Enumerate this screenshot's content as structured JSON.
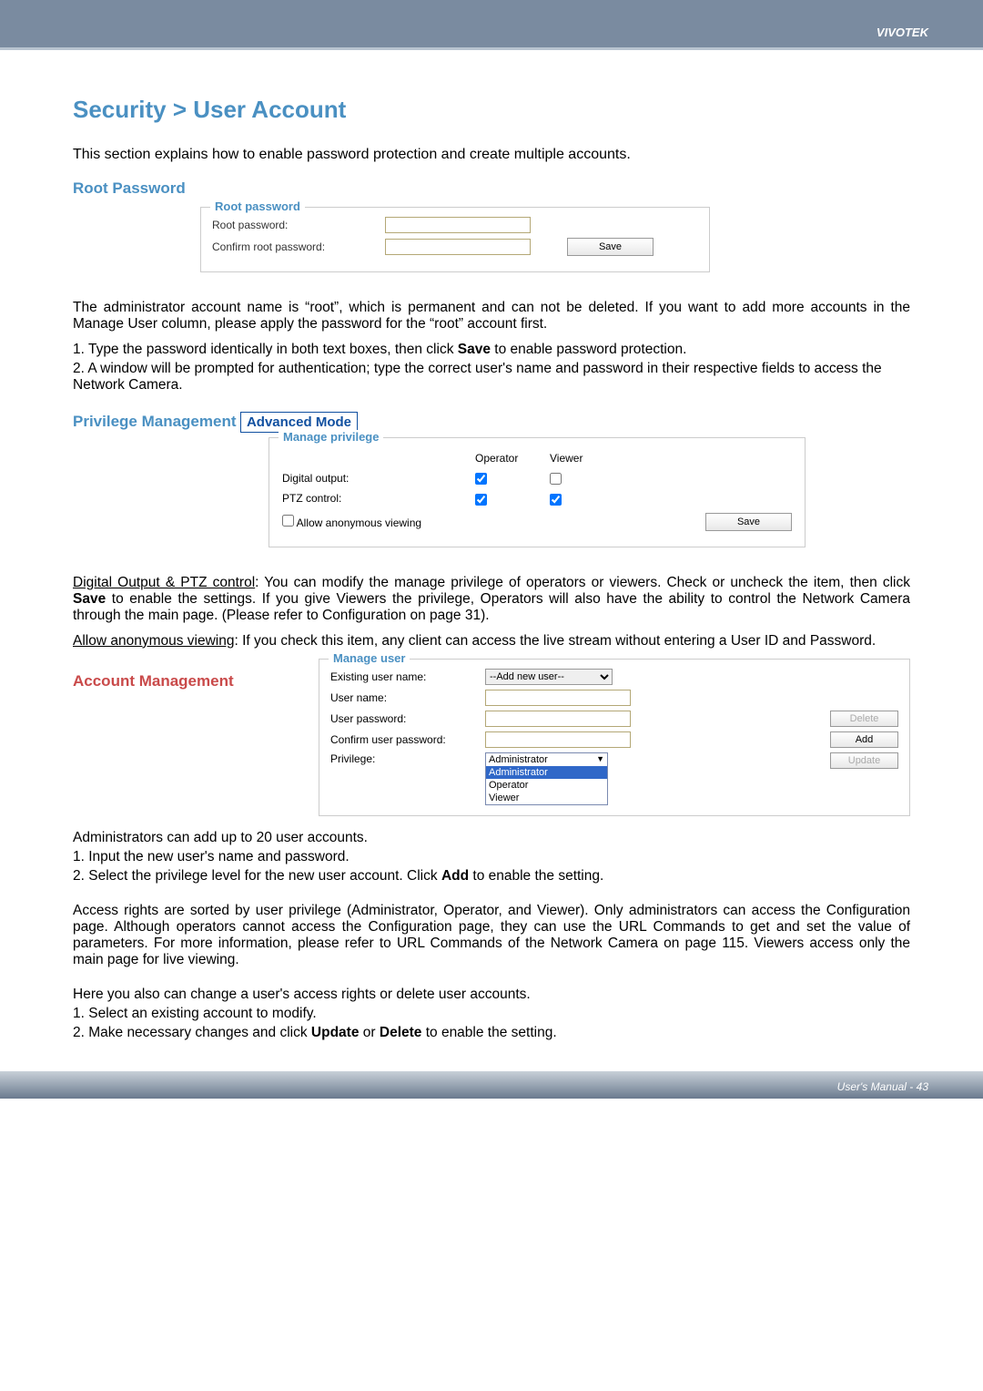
{
  "header": {
    "brand": "VIVOTEK"
  },
  "page": {
    "title": "Security > User Account",
    "intro": "This section explains how to enable password protection and create multiple accounts."
  },
  "root_password": {
    "heading": "Root Password",
    "legend": "Root password",
    "label_password": "Root password:",
    "label_confirm": "Confirm root password:",
    "save_label": "Save",
    "desc1": "The administrator account name is “root”, which is permanent and can not be deleted. If you want to add more accounts in the Manage User column, please apply the password for the “root” account first.",
    "desc2": "1. Type the password identically in both text boxes, then click Save to enable password protection.",
    "desc3": "2. A window will be prompted for authentication; type the correct user's name and password in their respective fields to access the Network Camera."
  },
  "privilege": {
    "heading": "Privilege Management",
    "mode_label": "Advanced Mode",
    "legend": "Manage privilege",
    "col_operator": "Operator",
    "col_viewer": "Viewer",
    "row_digital": "Digital output:",
    "row_ptz": "PTZ control:",
    "row_anon": "Allow anonymous viewing",
    "save_label": "Save",
    "desc_do_ptz_label": "Digital Output & PTZ control",
    "desc_do_ptz": ": You can modify the manage privilege of operators or viewers. Check or uncheck the item, then click Save to enable the settings. If you give Viewers the privilege, Operators will also have the ability to control the Network Camera through the main page. (Please refer to Configuration on page 31).",
    "desc_anon_label": "Allow anonymous viewing",
    "desc_anon": ": If you check this item, any client can access the live stream without entering a User ID and Password."
  },
  "account": {
    "heading": "Account Management",
    "legend": "Manage user",
    "label_existing": "Existing user name:",
    "label_username": "User name:",
    "label_userpass": "User password:",
    "label_confirm": "Confirm user password:",
    "label_privilege": "Privilege:",
    "existing_select": "--Add new user--",
    "priv_admin": "Administrator",
    "priv_operator": "Operator",
    "priv_viewer": "Viewer",
    "btn_delete": "Delete",
    "btn_add": "Add",
    "btn_update": "Update",
    "desc1": "Administrators can add up to 20 user accounts.",
    "desc2": "1. Input the new user's name and password.",
    "desc3": "2. Select the privilege level for the new user account. Click Add to enable the setting.",
    "desc4": "Access rights are sorted by user privilege (Administrator, Operator, and Viewer). Only administrators can access the Configuration page. Although operators cannot access the Configuration page, they can use the URL Commands to get and set the value of parameters. For more information, please refer to URL Commands of the Network Camera on page 115. Viewers access only the main page for live viewing.",
    "desc5": "Here you also can change a user's access rights or delete user accounts.",
    "desc6": "1. Select an existing account to modify.",
    "desc7": "2. Make necessary changes and click Update or Delete to enable the setting."
  },
  "footer": {
    "text": "User's Manual - 43"
  }
}
